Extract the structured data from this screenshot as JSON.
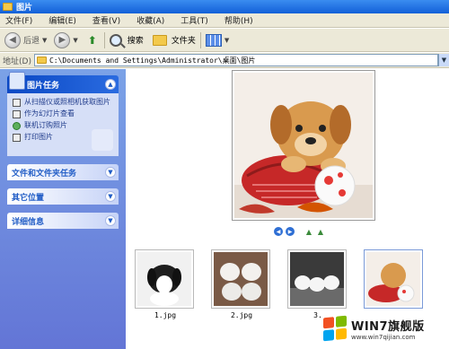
{
  "window": {
    "title": "图片"
  },
  "menu": {
    "items": [
      "文件(F)",
      "编辑(E)",
      "查看(V)",
      "收藏(A)",
      "工具(T)",
      "帮助(H)"
    ]
  },
  "toolbar": {
    "back_label": "后退",
    "search_label": "搜索",
    "folders_label": "文件夹"
  },
  "address": {
    "label": "地址(D)",
    "path": "C:\\Documents and Settings\\Administrator\\桌面\\图片"
  },
  "taskpane": {
    "picture_tasks": {
      "title": "图片任务",
      "items": [
        "从扫描仪或照相机获取图片",
        "作为幻灯片查看",
        "联机订购照片",
        "打印图片"
      ]
    },
    "file_tasks": {
      "title": "文件和文件夹任务"
    },
    "other_places": {
      "title": "其它位置"
    },
    "details": {
      "title": "详细信息"
    }
  },
  "thumbnails": [
    {
      "caption": "1.jpg"
    },
    {
      "caption": "2.jpg"
    },
    {
      "caption": "3."
    },
    {
      "caption": ""
    }
  ],
  "watermark": {
    "brand": "WIN7旗舰版",
    "site": "www.win7qijian.com"
  },
  "colors": {
    "titlebar": "#1260d8",
    "taskpane": "#7ba2e7",
    "panel_head": "#0a48c4"
  }
}
